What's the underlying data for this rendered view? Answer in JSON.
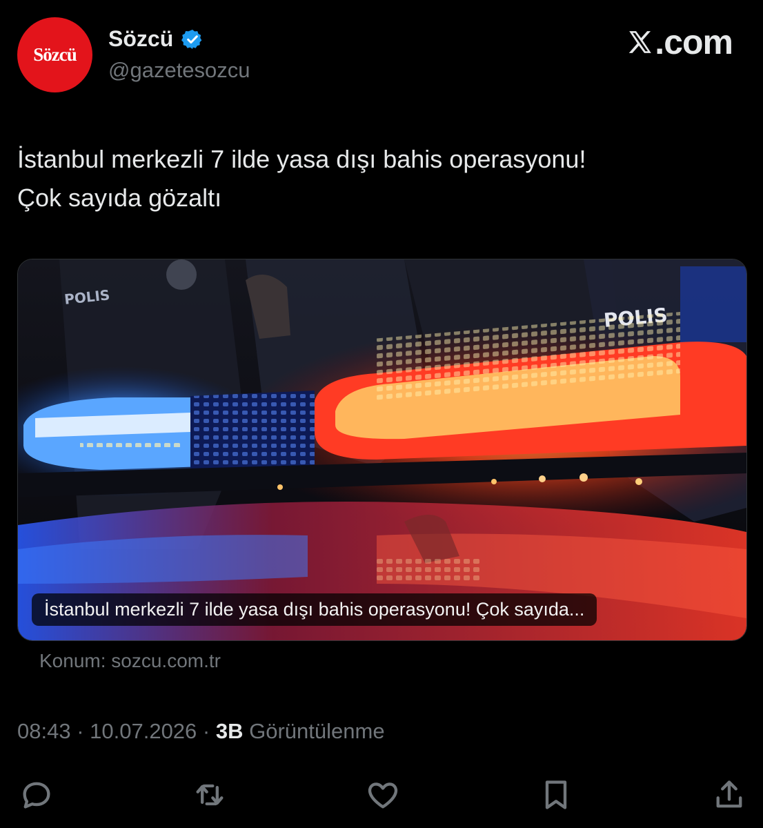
{
  "account": {
    "avatar_text": "Sözcü",
    "display_name": "Sözcü",
    "handle": "@gazetesozcu",
    "verified_color": "#1d9bf0"
  },
  "brand": {
    "label": ".com",
    "icon": "x-logo-icon"
  },
  "tweet": {
    "text_line1": "İstanbul merkezli 7 ilde yasa dışı bahis operasyonu!",
    "text_line2": "Çok sayıda gözaltı"
  },
  "link_card": {
    "caption": "İstanbul merkezli 7 ilde yasa dışı bahis operasyonu! Çok sayıda...",
    "image_text_1": "POLIS",
    "image_text_2": "POLIS",
    "source_label": "Konum: sozcu.com.tr"
  },
  "meta": {
    "time": "08:43",
    "separator": " · ",
    "date": "10.07.2026",
    "views_count": "3B",
    "views_label": " Görüntülenme"
  },
  "actions": [
    "reply-icon",
    "retweet-icon",
    "like-icon",
    "bookmark-icon",
    "share-icon"
  ],
  "colors": {
    "background": "#000000",
    "text": "#e7e9ea",
    "muted": "#71767b",
    "avatar_red": "#e3141b"
  }
}
